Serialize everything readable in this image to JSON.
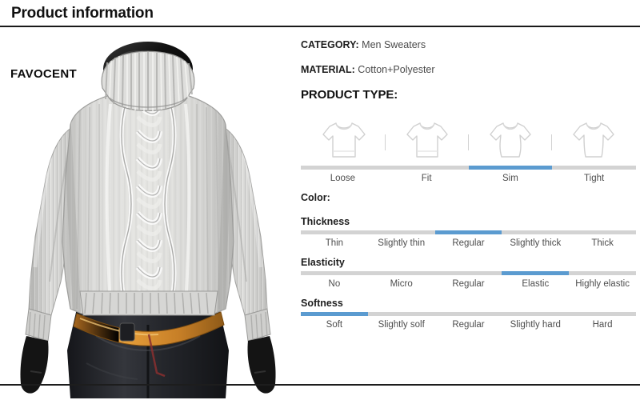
{
  "header": {
    "title": "Product information"
  },
  "photo": {
    "watermark": "FAVOCENT",
    "alt_name": "mens-cable-knit-turtleneck-sweater",
    "garment_color": "#d8d8d6",
    "pants_color": "#232323",
    "belt_color": "#c98a33"
  },
  "spec": {
    "category_key": "CATEGORY:",
    "category_value": "Men Sweaters",
    "material_key": "MATERIAL:",
    "material_value": "Cotton+Polyester",
    "product_type_heading": "PRODUCT TYPE:",
    "color_heading": "Color:",
    "accent_color": "#5b9bd0",
    "track_color": "#d3d3d3"
  },
  "product_type": {
    "icons": [
      "loose-shirt-icon",
      "fit-shirt-icon",
      "slim-shirt-icon",
      "tight-shirt-icon"
    ],
    "options": [
      "Loose",
      "Fit",
      "Sim",
      "Tight"
    ],
    "selected_index": 2,
    "selected": "Sim"
  },
  "thickness": {
    "heading": "Thickness",
    "options": [
      "Thin",
      "Slightly thin",
      "Regular",
      "Slightly thick",
      "Thick"
    ],
    "selected_index": 2,
    "selected": "Regular"
  },
  "elasticity": {
    "heading": "Elasticity",
    "options": [
      "No",
      "Micro",
      "Regular",
      "Elastic",
      "Highly elastic"
    ],
    "selected_index": 3,
    "selected": "Elastic"
  },
  "softness": {
    "heading": "Softness",
    "options": [
      "Soft",
      "Slightly solf",
      "Regular",
      "Slightly hard",
      "Hard"
    ],
    "selected_index": 0,
    "selected": "Soft"
  }
}
